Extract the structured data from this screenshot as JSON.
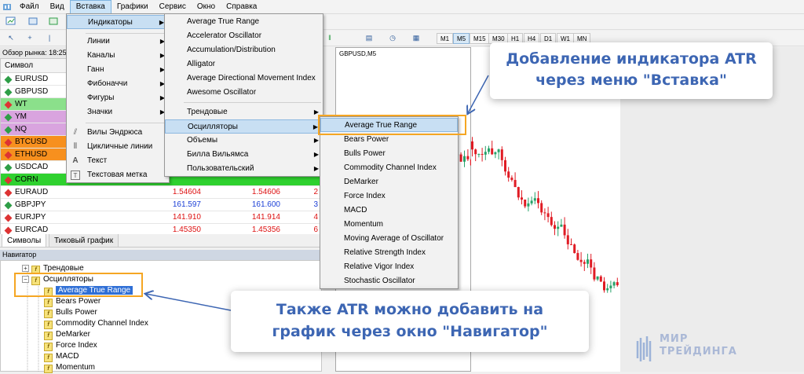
{
  "menubar": {
    "items": [
      "Файл",
      "Вид",
      "Вставка",
      "Графики",
      "Сервис",
      "Окно",
      "Справка"
    ]
  },
  "timeframes": [
    "M1",
    "M5",
    "M15",
    "M30",
    "H1",
    "H4",
    "D1",
    "W1",
    "MN"
  ],
  "market_watch": {
    "title": "Обзор рынка: 18:25",
    "column_symbol": "Символ",
    "rows": [
      {
        "symbol": "EURUSD",
        "bid": "",
        "ask": "",
        "spread": "",
        "bg": "#ffffff",
        "dia": "#2e9e47"
      },
      {
        "symbol": "GBPUSD",
        "bid": "",
        "ask": "",
        "spread": "",
        "bg": "#ffffff",
        "dia": "#2e9e47"
      },
      {
        "symbol": "WT",
        "bid": "",
        "ask": "",
        "spread": "",
        "bg": "#8be08b",
        "dia": "#d33"
      },
      {
        "symbol": "YM",
        "bid": "",
        "ask": "",
        "spread": "",
        "bg": "#d9a4df",
        "dia": "#2e9e47"
      },
      {
        "symbol": "NQ",
        "bid": "",
        "ask": "",
        "spread": "",
        "bg": "#d9a4df",
        "dia": "#2e9e47"
      },
      {
        "symbol": "BTCUSD",
        "bid": "",
        "ask": "",
        "spread": "",
        "bg": "#f7901e",
        "dia": "#d33"
      },
      {
        "symbol": "ETHUSD",
        "bid": "",
        "ask": "",
        "spread": "",
        "bg": "#f7901e",
        "dia": "#d33"
      },
      {
        "symbol": "USDCAD",
        "bid": "",
        "ask": "",
        "spread": "",
        "bg": "#ffffff",
        "dia": "#2e9e47"
      },
      {
        "symbol": "CORN",
        "bid": "",
        "ask": "",
        "spread": "",
        "bg": "#2fd12f",
        "dia": "#d33"
      },
      {
        "symbol": "EURAUD",
        "bid": "1.54604",
        "ask": "1.54606",
        "spread": "2",
        "bg": "#ffffff",
        "dia": "#d33",
        "color": "#d11"
      },
      {
        "symbol": "GBPJPY",
        "bid": "161.597",
        "ask": "161.600",
        "spread": "3",
        "bg": "#ffffff",
        "dia": "#2e9e47",
        "color": "#1b3fd6"
      },
      {
        "symbol": "EURJPY",
        "bid": "141.910",
        "ask": "141.914",
        "spread": "4",
        "bg": "#ffffff",
        "dia": "#d33",
        "color": "#d11"
      },
      {
        "symbol": "EURCAD",
        "bid": "1.45350",
        "ask": "1.45356",
        "spread": "6",
        "bg": "#ffffff",
        "dia": "#d33",
        "color": "#d11"
      }
    ],
    "tabs": [
      "Символы",
      "Тиковый график"
    ]
  },
  "navigator": {
    "title": "Навигатор",
    "items": [
      {
        "label": "Трендовые",
        "level": 1,
        "expander": "+"
      },
      {
        "label": "Осцилляторы",
        "level": 1,
        "expander": "−"
      },
      {
        "label": "Average True Range",
        "level": 2,
        "selected": true
      },
      {
        "label": "Bears Power",
        "level": 2
      },
      {
        "label": "Bulls Power",
        "level": 2
      },
      {
        "label": "Commodity Channel Index",
        "level": 2
      },
      {
        "label": "DeMarker",
        "level": 2
      },
      {
        "label": "Force Index",
        "level": 2
      },
      {
        "label": "MACD",
        "level": 2
      },
      {
        "label": "Momentum",
        "level": 2
      }
    ]
  },
  "chart": {
    "symbol": "GBPUSD,M5"
  },
  "insert_menu": {
    "items": [
      "Индикаторы",
      "Линии",
      "Каналы",
      "Ганн",
      "Фибоначчи",
      "Фигуры",
      "Значки",
      "Вилы Эндрюса",
      "Цикличные линии",
      "Текст",
      "Текстовая метка"
    ]
  },
  "indicators_menu": {
    "items": [
      "Average True Range",
      "Accelerator Oscillator",
      "Accumulation/Distribution",
      "Alligator",
      "Average Directional Movement Index",
      "Awesome Oscillator",
      "Трендовые",
      "Осцилляторы",
      "Объемы",
      "Билла Вильямса",
      "Пользовательский"
    ]
  },
  "oscillators_menu": {
    "items": [
      "Average True Range",
      "Bears Power",
      "Bulls Power",
      "Commodity Channel Index",
      "DeMarker",
      "Force Index",
      "MACD",
      "Momentum",
      "Moving Average of Oscillator",
      "Relative Strength Index",
      "Relative Vigor Index",
      "Stochastic Oscillator"
    ]
  },
  "callouts": {
    "top": "Добавление индикатора ATR через меню \"Вставка\"",
    "bottom": "Также ATR можно добавить на график через окно \"Навигатор\""
  },
  "logo": {
    "line1": "МИР",
    "line2": "ТРЕЙДИНГА"
  },
  "colors": {
    "accent": "#3d66b3",
    "highlight_border": "#f5a623",
    "menu_highlight": "#c8dff3"
  }
}
